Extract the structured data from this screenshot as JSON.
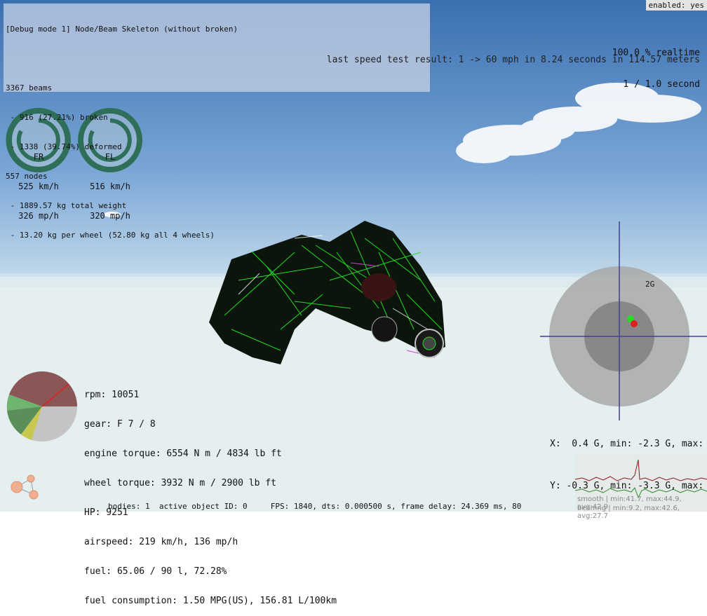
{
  "debug": {
    "title": "[Debug mode 1] Node/Beam Skeleton (without broken)",
    "beams": "3367 beams",
    "broken": " - 916 (27.21%) broken",
    "deformed": " - 1338 (39.74%) deformed",
    "nodes": "557 nodes",
    "weight": " - 1889.57 kg total weight",
    "per_wheel": " - 13.20 kg per wheel (52.80 kg all 4 wheels)"
  },
  "enabled": "enabled: yes",
  "realtime": {
    "percent": "100.0 % realtime",
    "ratio": "1 / 1.0 second"
  },
  "speedtest": "last speed test result: 1 -> 60 mph in 8.24 seconds in 114.57 meters",
  "wheels": [
    {
      "name": "FR",
      "kmh": "525 km/h",
      "mph": "326 mp/h"
    },
    {
      "name": "FL",
      "kmh": "516 km/h",
      "mph": "320 mp/h"
    }
  ],
  "stats": {
    "rpm": "rpm: 10051",
    "gear": "gear: F 7 / 8",
    "engine_torque": "engine torque: 6554 N m / 4834 lb ft",
    "wheel_torque": "wheel torque: 3932 N m / 2900 lb ft",
    "hp": "HP: 9251",
    "airspeed": "airspeed: 219 km/h, 136 mp/h",
    "fuel": "fuel: 65.06 / 90 l, 72.28%",
    "consumption": "fuel consumption: 1.50 MPG(US), 156.81 L/100km"
  },
  "gforce": {
    "label": "2G",
    "x_line": "X:  0.4 G, min: -2.3 G, max:",
    "y_line": "Y: -0.3 G, min: -3.3 G, max:"
  },
  "bottom": "bodies: 1  active object ID: 0     FPS: 1840, dts: 0.000500 s, frame delay: 24.369 ms, 80",
  "graph": {
    "smooth": "smooth | min:41.7, max:44.9, avg:42.9",
    "beamng": "beamng | min:9.2, max:42.6, avg:27.7"
  },
  "colors": {
    "sky_top": "#3a6fb0",
    "ground": "#e8f0f0",
    "mesh": "#22dd22",
    "gauge": "#2f6e58"
  }
}
